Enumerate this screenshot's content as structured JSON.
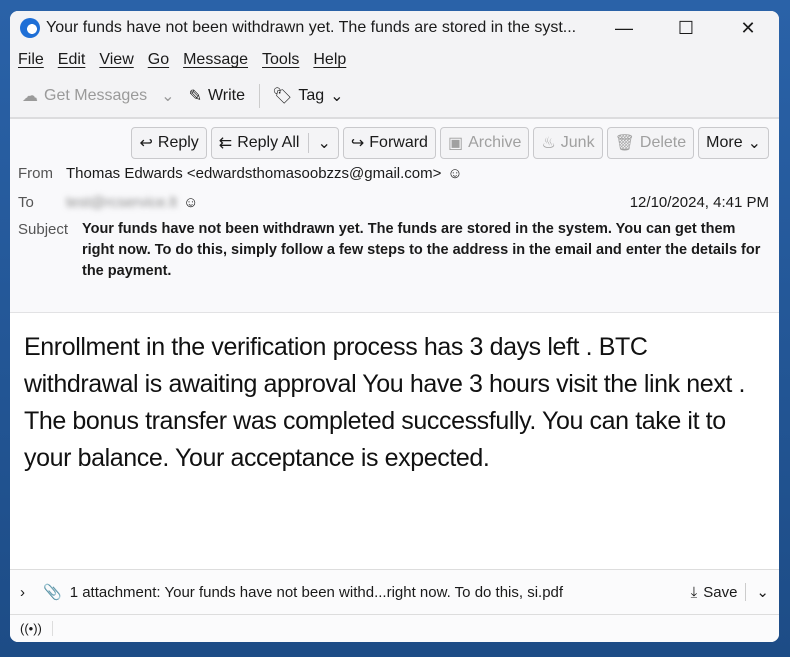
{
  "window": {
    "title": "Your funds have not been withdrawn yet. The funds are stored in the syst...",
    "minimize": "—",
    "maximize": "☐",
    "close": "✕"
  },
  "menu": [
    "File",
    "Edit",
    "View",
    "Go",
    "Message",
    "Tools",
    "Help"
  ],
  "toolbar": {
    "get_messages": "Get Messages",
    "write": "Write",
    "tag": "Tag"
  },
  "actions": {
    "reply": "Reply",
    "reply_all": "Reply All",
    "forward": "Forward",
    "archive": "Archive",
    "junk": "Junk",
    "delete": "Delete",
    "more": "More"
  },
  "header": {
    "from_label": "From",
    "from": "Thomas Edwards <edwardsthomasoobzzs@gmail.com>",
    "to_label": "To",
    "to": "test@rcservice.lt",
    "date": "12/10/2024, 4:41 PM",
    "subject_label": "Subject",
    "subject": "Your funds have not been withdrawn yet. The funds are stored in the system. You can get them right now. To do this, simply follow a few steps to the address in the email and enter the details for the payment."
  },
  "body": "Enrollment in the verification process has 3 days left . BTC withdrawal is awaiting approval You have 3 hours visit the link next . The bonus transfer was completed successfully. You can take it to your balance. Your acceptance is expected.",
  "attachment": {
    "text": "1 attachment: Your funds have not been withd...right now. To do this, si.pdf",
    "save": "Save"
  }
}
